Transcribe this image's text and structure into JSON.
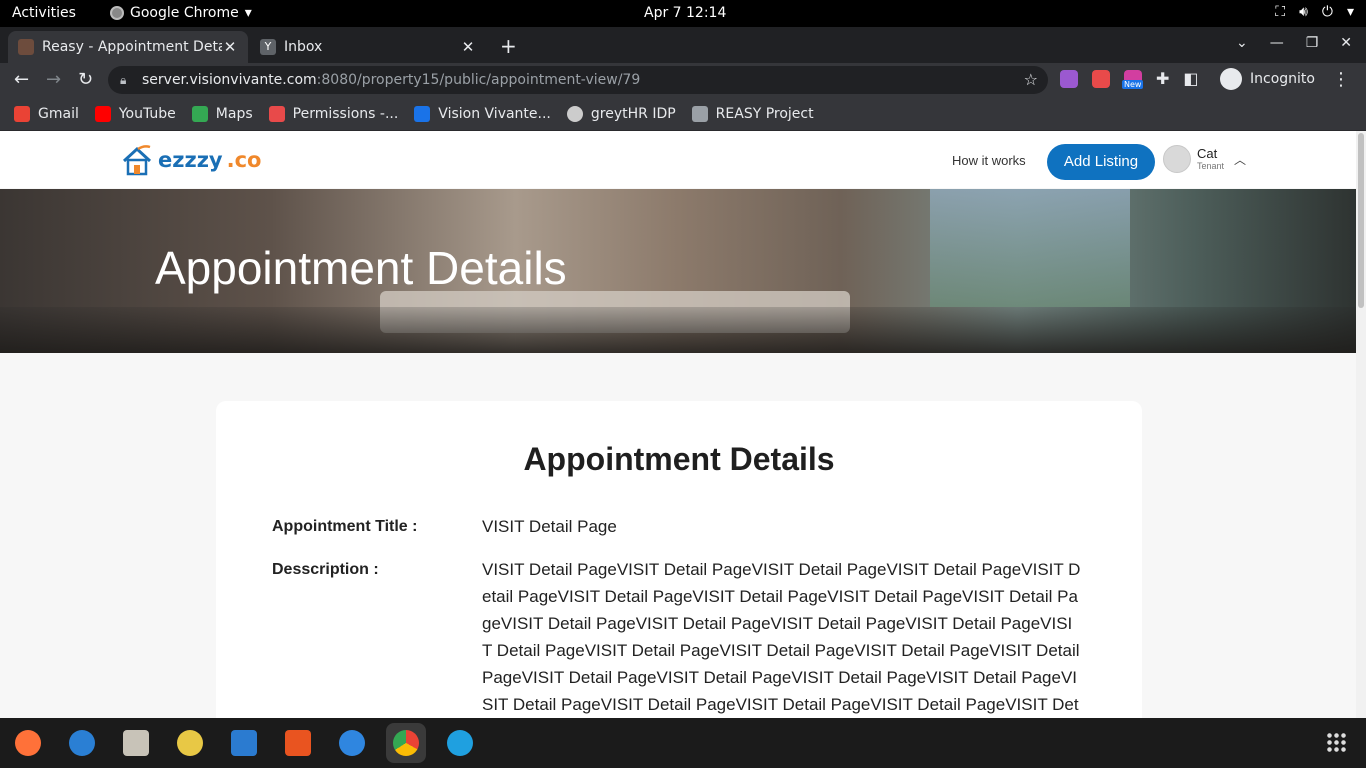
{
  "system": {
    "activities": "Activities",
    "app_name": "Google Chrome",
    "clock": "Apr 7  12:14"
  },
  "tabs": [
    {
      "label": "Reasy - Appointment Deta",
      "active": true
    },
    {
      "label": "Inbox",
      "active": false
    }
  ],
  "address_bar": {
    "host": "server.visionvivante.com",
    "path": ":8080/property15/public/appointment-view/79"
  },
  "extensions": {
    "new_badge": "New"
  },
  "profile": {
    "label": "Incognito"
  },
  "bookmarks": [
    {
      "label": "Gmail",
      "color": "#ea4335"
    },
    {
      "label": "YouTube",
      "color": "#ff0000"
    },
    {
      "label": "Maps",
      "color": "#34a853"
    },
    {
      "label": "Permissions -...",
      "color": "#e84a4a"
    },
    {
      "label": "Vision Vivante...",
      "color": "#1a73e8"
    },
    {
      "label": "greytHR IDP",
      "color": "#cccccc"
    },
    {
      "label": "REASY Project",
      "color": "#9aa0a6"
    }
  ],
  "site": {
    "brand_part1": "ezzzy",
    "brand_part2": ".co",
    "nav_link": "How it works",
    "add_listing": "Add Listing",
    "user_name": "Cat",
    "user_role": "Tenant",
    "hero_title": "Appointment Details"
  },
  "card": {
    "title": "Appointment Details",
    "title_label": "Appointment Title :",
    "title_value": "VISIT Detail Page",
    "desc_label": "Desscription :",
    "desc_value": "VISIT Detail PageVISIT Detail PageVISIT Detail PageVISIT Detail PageVISIT Detail PageVISIT Detail PageVISIT Detail PageVISIT Detail PageVISIT Detail PageVISIT Detail PageVISIT Detail PageVISIT Detail PageVISIT Detail PageVISIT Detail PageVISIT Detail PageVISIT Detail PageVISIT Detail PageVISIT Detail PageVISIT Detail PageVISIT Detail PageVISIT Detail PageVISIT Detail PageVISIT Detail PageVISIT Detail PageVISIT Detail PageVISIT Detail PageVISIT Detail PageVISIT Detail PageVISIT Detail PageVISIT Detail"
  },
  "colors": {
    "brand_blue": "#1a6fb5",
    "brand_orange": "#f0882b",
    "button_blue": "#0f72c0"
  },
  "dock": [
    {
      "name": "firefox",
      "color": "#ff7139"
    },
    {
      "name": "thunderbird",
      "color": "#2a7fd4"
    },
    {
      "name": "files",
      "color": "#c8c3b8"
    },
    {
      "name": "rhythmbox",
      "color": "#e8c845"
    },
    {
      "name": "writer",
      "color": "#2b7bd0"
    },
    {
      "name": "software",
      "color": "#e95420"
    },
    {
      "name": "help",
      "color": "#2f86e0"
    },
    {
      "name": "chrome",
      "color": "#34a853"
    },
    {
      "name": "edge",
      "color": "#1fa0e0"
    }
  ]
}
